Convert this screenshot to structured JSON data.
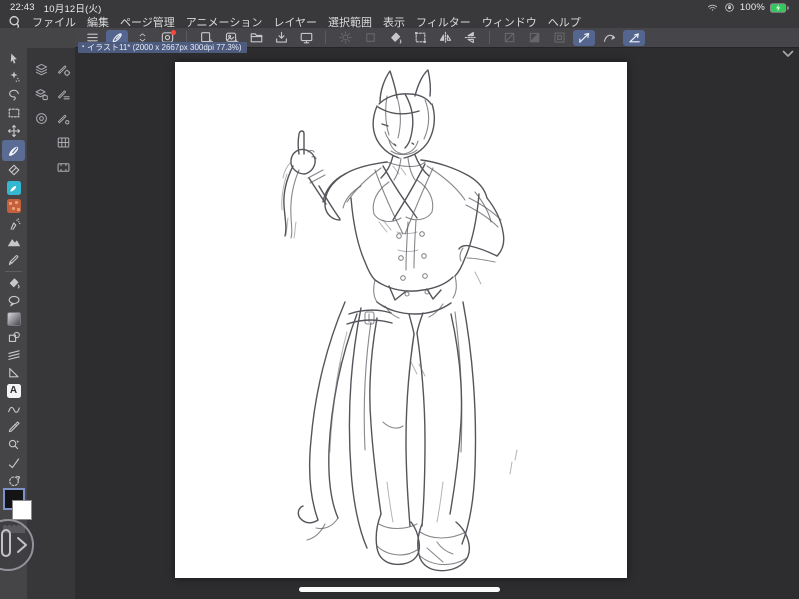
{
  "status_bar": {
    "time": "22:43",
    "date": "10月12日(火)",
    "battery_percent": "100%",
    "icons": [
      "wifi-icon",
      "orientation-lock-icon",
      "battery-charging-icon"
    ],
    "battery_color": "#34c759"
  },
  "menu_bar": {
    "logo_icon": "clip-studio-paint-logo",
    "menus": [
      "ファイル",
      "編集",
      "ページ管理",
      "アニメーション",
      "レイヤー",
      "選択範囲",
      "表示",
      "フィルター",
      "ウィンドウ",
      "ヘルプ"
    ]
  },
  "command_bar": {
    "buttons": [
      {
        "icon": "main-menu-icon",
        "state": "normal"
      },
      {
        "icon": "touch-pen-mode-icon",
        "state": "active"
      },
      {
        "icon": "expand-toolbar-icon",
        "state": "normal"
      },
      {
        "icon": "app-settings-icon",
        "state": "normal",
        "badge": true
      },
      {
        "icon": "new-canvas-icon",
        "state": "normal"
      },
      {
        "icon": "new-from-gallery-icon",
        "state": "normal"
      },
      {
        "icon": "open-file-icon",
        "state": "normal"
      },
      {
        "icon": "save-icon",
        "state": "normal"
      },
      {
        "icon": "export-icon",
        "state": "normal"
      },
      {
        "icon": "color-adjust-icon",
        "state": "disabled"
      },
      {
        "icon": "selection-icon",
        "state": "disabled"
      },
      {
        "icon": "fill-icon",
        "state": "normal"
      },
      {
        "icon": "transform-icon",
        "state": "normal"
      },
      {
        "icon": "flip-horizontal-icon",
        "state": "normal"
      },
      {
        "icon": "flip-vertical-icon",
        "state": "normal"
      },
      {
        "icon": "clip-layer-icon",
        "state": "disabled"
      },
      {
        "icon": "lock-transparent-icon",
        "state": "disabled"
      },
      {
        "icon": "reference-layer-icon",
        "state": "disabled"
      },
      {
        "icon": "snap-ruler-icon",
        "state": "active"
      },
      {
        "icon": "snap-special-ruler-icon",
        "state": "normal"
      },
      {
        "icon": "snap-grid-icon",
        "state": "active"
      }
    ]
  },
  "canvas": {
    "tab_indicator": "▪",
    "tab_label": "イラスト11* (2000 x 2667px 300dpi 77.3%)"
  },
  "tool_palette": {
    "selected": "pen-tool",
    "text_tool_glyph": "A",
    "tools": [
      "operation-tool",
      "auto-select-tool",
      "lasso-tool",
      "marquee-tool",
      "move-tool",
      "pen-tool",
      "eraser-tool",
      "blend-tool",
      "decoration-tool",
      "airbrush-tool",
      "brush-tool",
      "pencil-tool",
      "fill-tool",
      "balloon-tool",
      "gradient-tool",
      "figure-tool",
      "ruler-tool",
      "frame-border-tool",
      "text-tool",
      "correct-line-tool",
      "eyedropper-tool",
      "object-tool",
      "line-check-tool",
      "rotate-canvas-tool",
      "zoom-tool"
    ]
  },
  "palette_dock": {
    "buttons": [
      "layer-palette",
      "layer-property-palette",
      "navigator-palette",
      "sub-tool-detail-palette",
      "tool-property-palette",
      "brush-size-palette",
      "quick-access-palette",
      "timeline-palette"
    ]
  },
  "color_area": {
    "main_color": "#141417",
    "sub_color": "#ffffff"
  },
  "colors": {
    "accent_blue": "#54668f",
    "badge_red": "#ff453a",
    "battery_green": "#34c759"
  }
}
